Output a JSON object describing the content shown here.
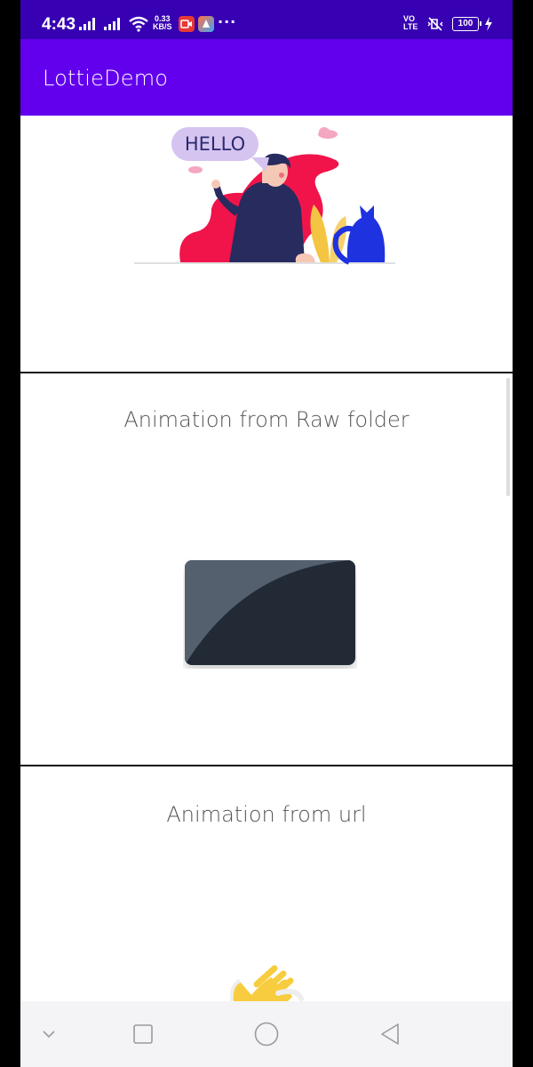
{
  "status_bar": {
    "time": "4:43",
    "net_speed_value": "0.33",
    "net_speed_unit": "KB/S",
    "dots": "···",
    "volte_top": "VO",
    "volte_bottom": "LTE",
    "battery": "100",
    "colors": {
      "background": "#3700b3"
    }
  },
  "app_bar": {
    "title": "LottieDemo",
    "color": "#6200ee"
  },
  "cards": {
    "hello": {
      "bubble_text": "HELLO"
    },
    "raw": {
      "title": "Animation from Raw folder"
    },
    "url": {
      "title": "Animation from url"
    }
  },
  "nav_bar": {
    "buttons": [
      "chevron-down-icon",
      "recents-icon",
      "home-icon",
      "back-icon"
    ]
  }
}
